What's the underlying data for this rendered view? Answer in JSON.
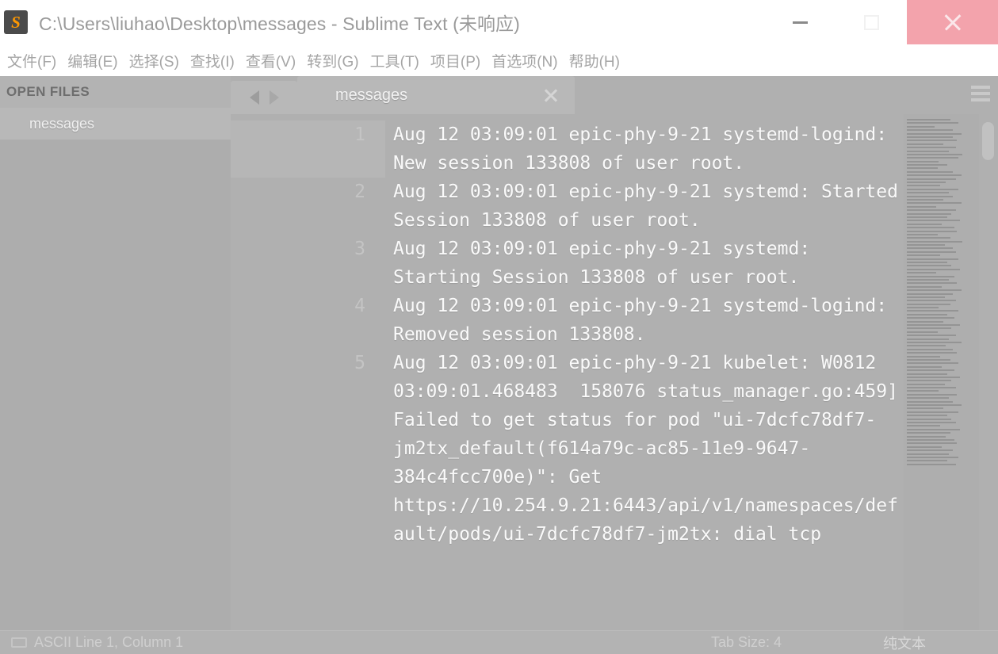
{
  "window": {
    "title": "C:\\Users\\liuhao\\Desktop\\messages - Sublime Text (未响应)",
    "logo_letter": "S",
    "controls": {
      "minimize_name": "minimize",
      "maximize_name": "maximize",
      "close_name": "close"
    },
    "accent_close_bg": "#f3a3ac",
    "logo_bg": "#4b4b4b",
    "logo_fg": "#ff9800"
  },
  "menubar": {
    "items": [
      {
        "label": "文件(F)"
      },
      {
        "label": "编辑(E)"
      },
      {
        "label": "选择(S)"
      },
      {
        "label": "查找(I)"
      },
      {
        "label": "查看(V)"
      },
      {
        "label": "转到(G)"
      },
      {
        "label": "工具(T)"
      },
      {
        "label": "项目(P)"
      },
      {
        "label": "首选项(N)"
      },
      {
        "label": "帮助(H)"
      }
    ]
  },
  "sidebar": {
    "header": "OPEN FILES",
    "items": [
      {
        "label": "messages",
        "selected": true
      }
    ]
  },
  "tabbar": {
    "nav_back_icon": "arrow-left-icon",
    "nav_forward_icon": "arrow-forward-icon",
    "tabs": [
      {
        "label": "messages",
        "active": true,
        "close_icon": "close-icon"
      }
    ],
    "menu_icon": "hamburger-menu-icon"
  },
  "editor": {
    "active_line": 1,
    "lines": [
      {
        "number": "1",
        "text": "Aug 12 03:09:01 epic-phy-9-21 systemd-logind: New session 133808 of user root."
      },
      {
        "number": "2",
        "text": "Aug 12 03:09:01 epic-phy-9-21 systemd: Started Session 133808 of user root."
      },
      {
        "number": "3",
        "text": "Aug 12 03:09:01 epic-phy-9-21 systemd: Starting Session 133808 of user root."
      },
      {
        "number": "4",
        "text": "Aug 12 03:09:01 epic-phy-9-21 systemd-logind: Removed session 133808."
      },
      {
        "number": "5",
        "text": "Aug 12 03:09:01 epic-phy-9-21 kubelet: W0812 03:09:01.468483  158076 status_manager.go:459] Failed to get status for pod \"ui-7dcfc78df7-jm2tx_default(f614a79c-ac85-11e9-9647-384c4fcc700e)\": Get https://10.254.9.21:6443/api/v1/namespaces/default/pods/ui-7dcfc78df7-jm2tx: dial tcp"
      }
    ]
  },
  "minimap": {
    "visible": true,
    "line_widths": [
      62,
      74,
      40,
      66,
      78,
      66,
      72,
      52,
      70,
      60,
      80,
      74,
      46,
      58,
      44,
      66,
      78,
      70,
      56,
      48,
      74,
      60,
      66,
      52,
      78,
      42,
      70,
      64,
      58,
      76,
      50,
      68,
      72,
      44,
      62,
      80,
      54,
      66,
      70,
      48,
      74,
      58,
      64,
      76,
      42,
      68,
      60,
      72,
      50,
      78,
      66,
      54,
      70,
      62,
      46,
      74,
      58,
      68,
      52,
      76,
      64,
      44,
      70,
      60,
      78,
      56,
      66,
      72,
      48,
      62,
      74,
      50,
      68,
      58,
      76,
      64,
      54,
      70,
      46,
      72,
      60,
      66,
      78,
      52,
      74,
      58,
      64,
      70,
      48,
      76,
      62,
      56,
      68,
      72,
      50,
      66,
      60,
      74,
      58,
      70
    ]
  },
  "scrollbar": {
    "name": "vertical-scrollbar",
    "thumb_name": "scrollbar-thumb"
  },
  "statusbar": {
    "left": "ASCII Line 1, Column 1",
    "tab_size": "Tab Size: 4",
    "syntax": "纯文本"
  }
}
